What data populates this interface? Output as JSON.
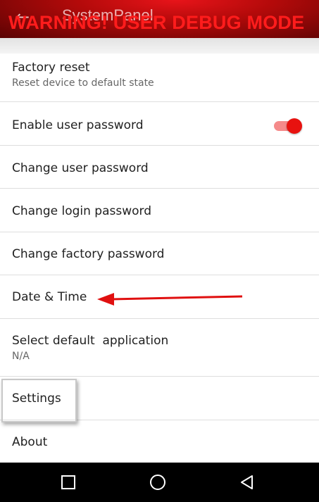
{
  "toolbar": {
    "back_icon": "arrow-back-icon",
    "title": "SystemPanel",
    "warning": "WARNING! USER DEBUG MODE"
  },
  "settings_list": [
    {
      "label": "Factory reset",
      "subtitle": "Reset device to default state"
    },
    {
      "label": "Enable user password",
      "toggle": true
    },
    {
      "label": "Change user password"
    },
    {
      "label": "Change login password"
    },
    {
      "label": "Change factory password"
    },
    {
      "label": "Date & Time"
    },
    {
      "label": "Select default  application",
      "subtitle": "N/A"
    },
    {
      "label": "Settings"
    },
    {
      "label": "About"
    }
  ],
  "navbar": {
    "recents_icon": "square-icon",
    "home_icon": "circle-icon",
    "back_icon": "triangle-back-icon"
  },
  "colors": {
    "toolbar_red": "#b30a0a",
    "warning_text": "#ff1c1c",
    "toggle_on": "#e8120f",
    "arrow": "#e01010"
  }
}
